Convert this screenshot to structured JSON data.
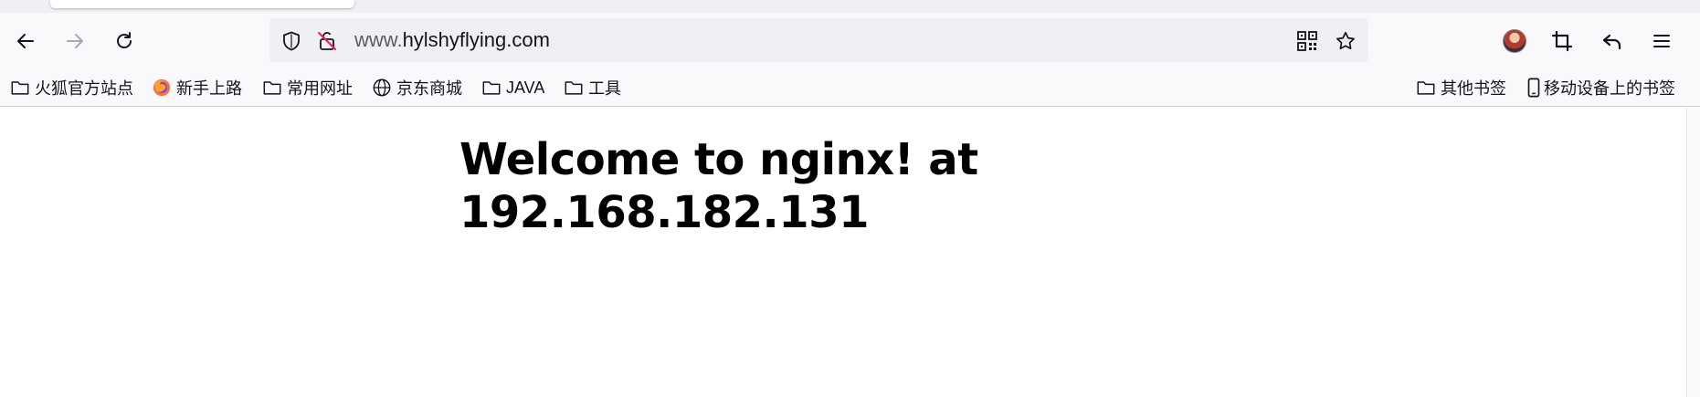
{
  "browser": {
    "address_prefix": "www.",
    "address_domain": "hylshyflying.com"
  },
  "bookmarks": {
    "left": [
      {
        "label": "火狐官方站点",
        "icon": "folder-icon"
      },
      {
        "label": "新手上路",
        "icon": "firefox-icon"
      },
      {
        "label": "常用网址",
        "icon": "folder-icon"
      },
      {
        "label": "京东商城",
        "icon": "globe-icon"
      },
      {
        "label": "JAVA",
        "icon": "folder-icon"
      },
      {
        "label": "工具",
        "icon": "folder-icon"
      }
    ],
    "right": [
      {
        "label": "其他书签",
        "icon": "folder-icon"
      },
      {
        "label": "移动设备上的书签",
        "icon": "mobile-icon"
      }
    ]
  },
  "page": {
    "heading": "Welcome to nginx! at 192.168.182.131"
  },
  "colors": {
    "toolbar_bg": "#f9f9fb",
    "urlbar_bg": "#f0f0f4",
    "text": "#15141a"
  }
}
